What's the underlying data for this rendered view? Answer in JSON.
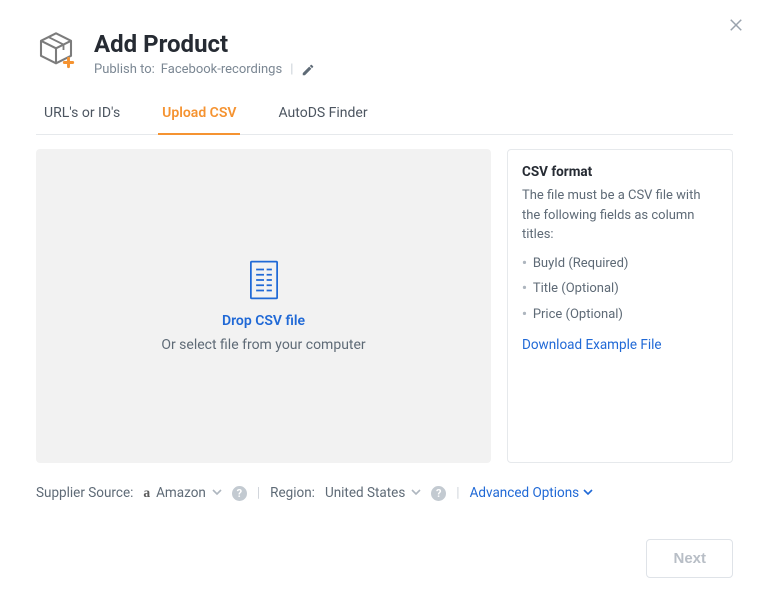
{
  "header": {
    "title": "Add Product",
    "publish_label": "Publish to:",
    "publish_target": "Facebook-recordings"
  },
  "tabs": {
    "items": [
      {
        "label": "URL's or ID's"
      },
      {
        "label": "Upload CSV"
      },
      {
        "label": "AutoDS Finder"
      }
    ]
  },
  "dropzone": {
    "title": "Drop CSV file",
    "subtitle": "Or select file from your computer"
  },
  "csv_format": {
    "heading": "CSV format",
    "description": "The file must be a CSV file with the following fields as column titles:",
    "fields": [
      "BuyId (Required)",
      "Title (Optional)",
      "Price (Optional)"
    ],
    "download": "Download Example File"
  },
  "toolbar": {
    "supplier_label": "Supplier Source:",
    "supplier_value": "Amazon",
    "region_label": "Region:",
    "region_value": "United States",
    "advanced": "Advanced Options"
  },
  "footer": {
    "next": "Next"
  }
}
